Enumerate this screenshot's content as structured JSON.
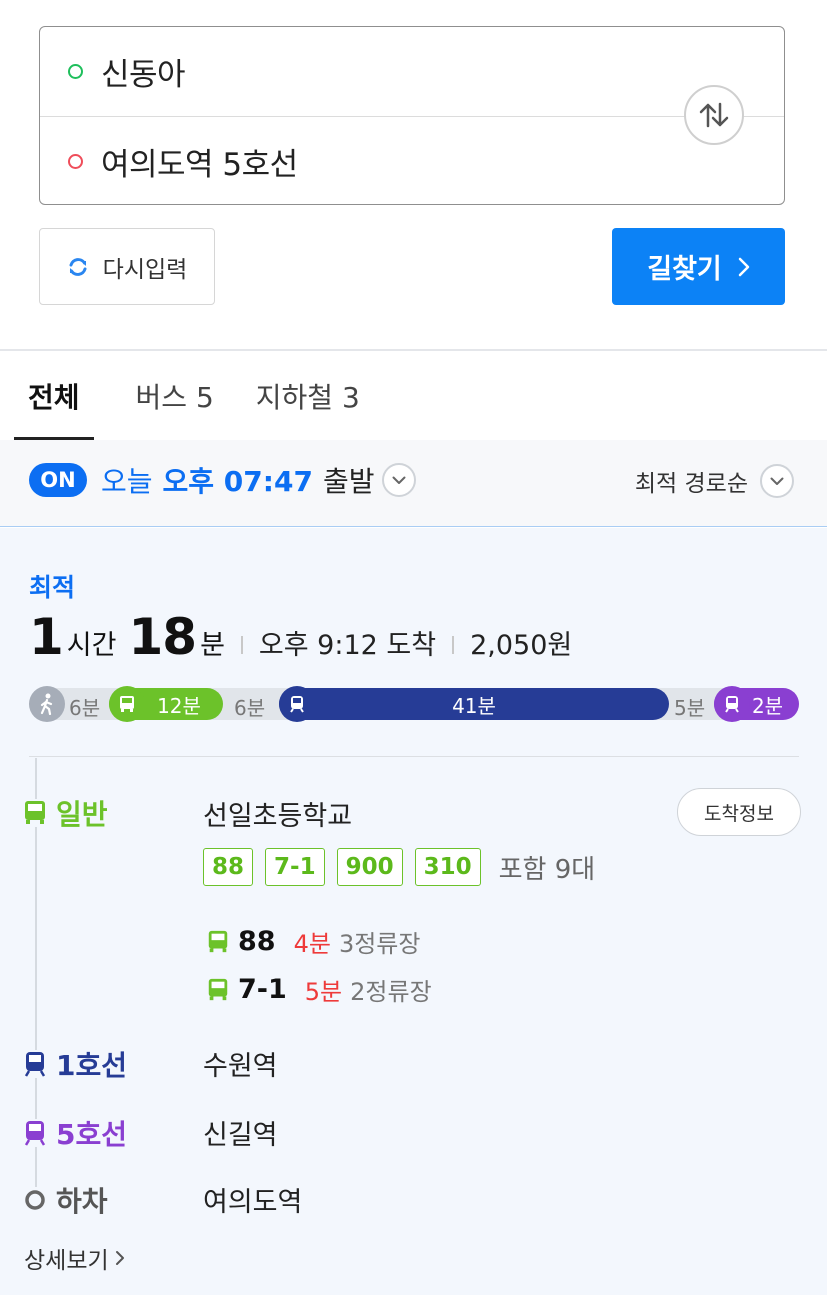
{
  "route": {
    "start": "신동아",
    "end": "여의도역 5호선"
  },
  "buttons": {
    "reset": "다시입력",
    "search": "길찾기"
  },
  "tabs": [
    {
      "label": "전체"
    },
    {
      "label": "버스 5"
    },
    {
      "label": "지하철 3"
    }
  ],
  "time_bar": {
    "badge": "ON",
    "day": "오늘",
    "time": "오후 07:47",
    "suffix": "출발",
    "sort": "최적 경로순"
  },
  "result": {
    "tag": "최적",
    "hours": "1",
    "hours_unit": "시간",
    "minutes": "18",
    "minutes_unit": "분",
    "arrival": "오후 9:12 도착",
    "fare": "2,050원",
    "segments": {
      "walk1": "6분",
      "bus": "12분",
      "walk2": "6분",
      "line1": "41분",
      "walk3": "5분",
      "line5": "2분"
    },
    "arrival_info": "도착정보",
    "steps": [
      {
        "mode": "일반",
        "station": "선일초등학교"
      },
      {
        "mode": "1호선",
        "station": "수원역"
      },
      {
        "mode": "5호선",
        "station": "신길역"
      },
      {
        "mode": "하차",
        "station": "여의도역"
      }
    ],
    "chips": [
      "88",
      "7-1",
      "900",
      "310"
    ],
    "chips_more": "포함 9대",
    "bus_arrivals": [
      {
        "num": "88",
        "mins": "4분",
        "stops": "3정류장"
      },
      {
        "num": "7-1",
        "mins": "5분",
        "stops": "2정류장"
      }
    ],
    "detail": "상세보기"
  },
  "colors": {
    "accent": "#0c82f6",
    "bus_green": "#6cc22a",
    "line1": "#263c96",
    "line5": "#8a3fd1",
    "red": "#ee3a3a"
  }
}
